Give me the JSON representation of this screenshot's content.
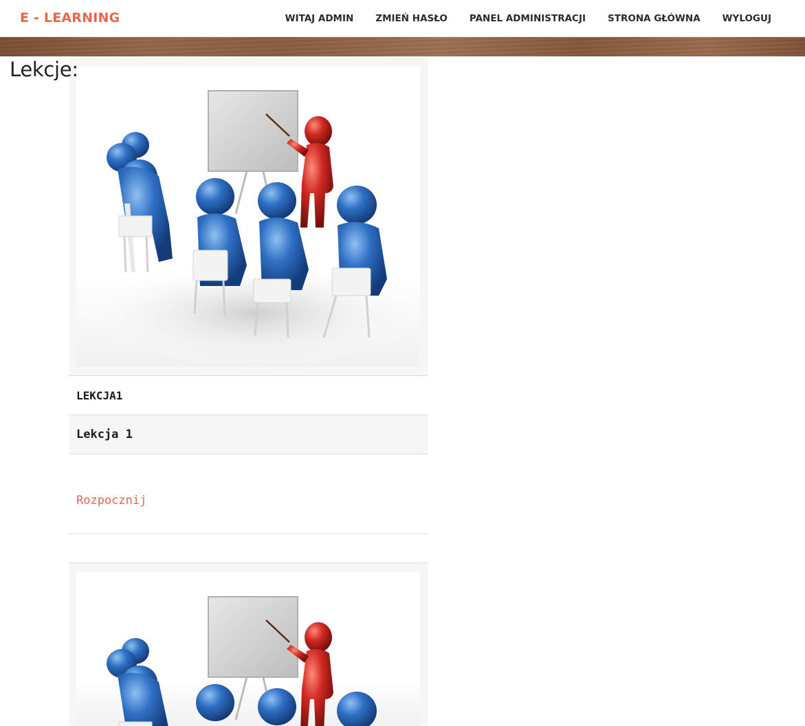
{
  "app": {
    "brand": "E - LEARNING"
  },
  "nav": {
    "items": [
      {
        "label": "WITAJ ADMIN"
      },
      {
        "label": "ZMIEŃ HASŁO"
      },
      {
        "label": "PANEL ADMINISTRACJI"
      },
      {
        "label": "STRONA GŁÓWNA"
      },
      {
        "label": "WYLOGUJ"
      }
    ]
  },
  "page": {
    "heading": "Lekcje:"
  },
  "lessons": [
    {
      "title": "LEKCJA1",
      "description": "Lekcja 1",
      "start_label": "Rozpocznij",
      "image": "classroom-presentation-illustration"
    },
    {
      "image": "classroom-presentation-illustration"
    }
  ],
  "colors": {
    "accent": "#e8664a",
    "student": "#2f6fc4",
    "teacher": "#d02a22",
    "card_bg": "#f6f6f6"
  }
}
